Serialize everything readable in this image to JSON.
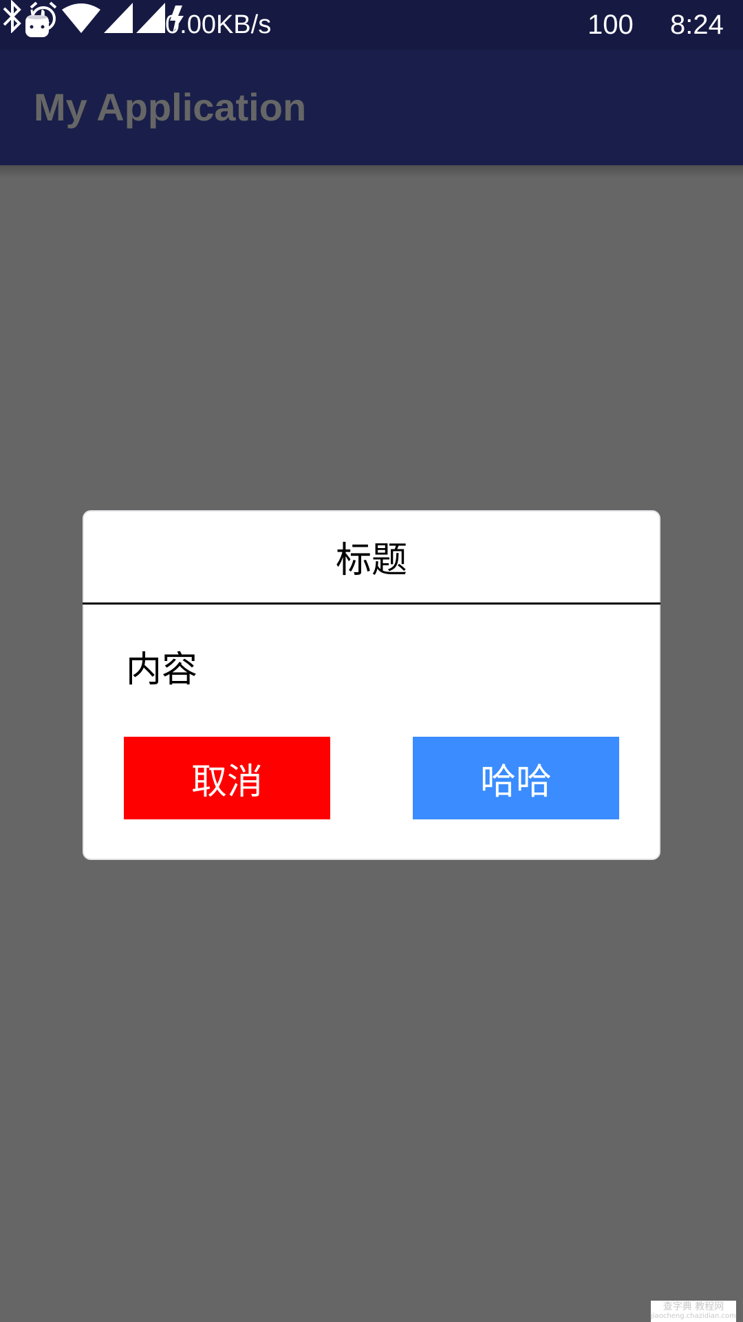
{
  "status_bar": {
    "net_speed": "0.00KB/s",
    "battery_level": "100",
    "time": "8:24",
    "icons": {
      "notification": "android-icon",
      "bluetooth": "bluetooth-icon",
      "alarm": "alarm-icon",
      "wifi": "wifi-icon",
      "signal_1": "cell-signal-icon",
      "signal_2": "cell-signal-icon",
      "charging": "charging-bolt-icon"
    },
    "background_color": "#161a42"
  },
  "app_bar": {
    "title": "My Application",
    "background_color": "#191f4a"
  },
  "dialog": {
    "title": "标题",
    "content": "内容",
    "cancel_label": "取消",
    "confirm_label": "哈哈",
    "cancel_color": "#ff0000",
    "confirm_color": "#3a8cff"
  },
  "overlay_color": "#666666",
  "watermark": {
    "line1": "查字典 教程网",
    "line2": "jiaocheng.chazidian.com"
  }
}
